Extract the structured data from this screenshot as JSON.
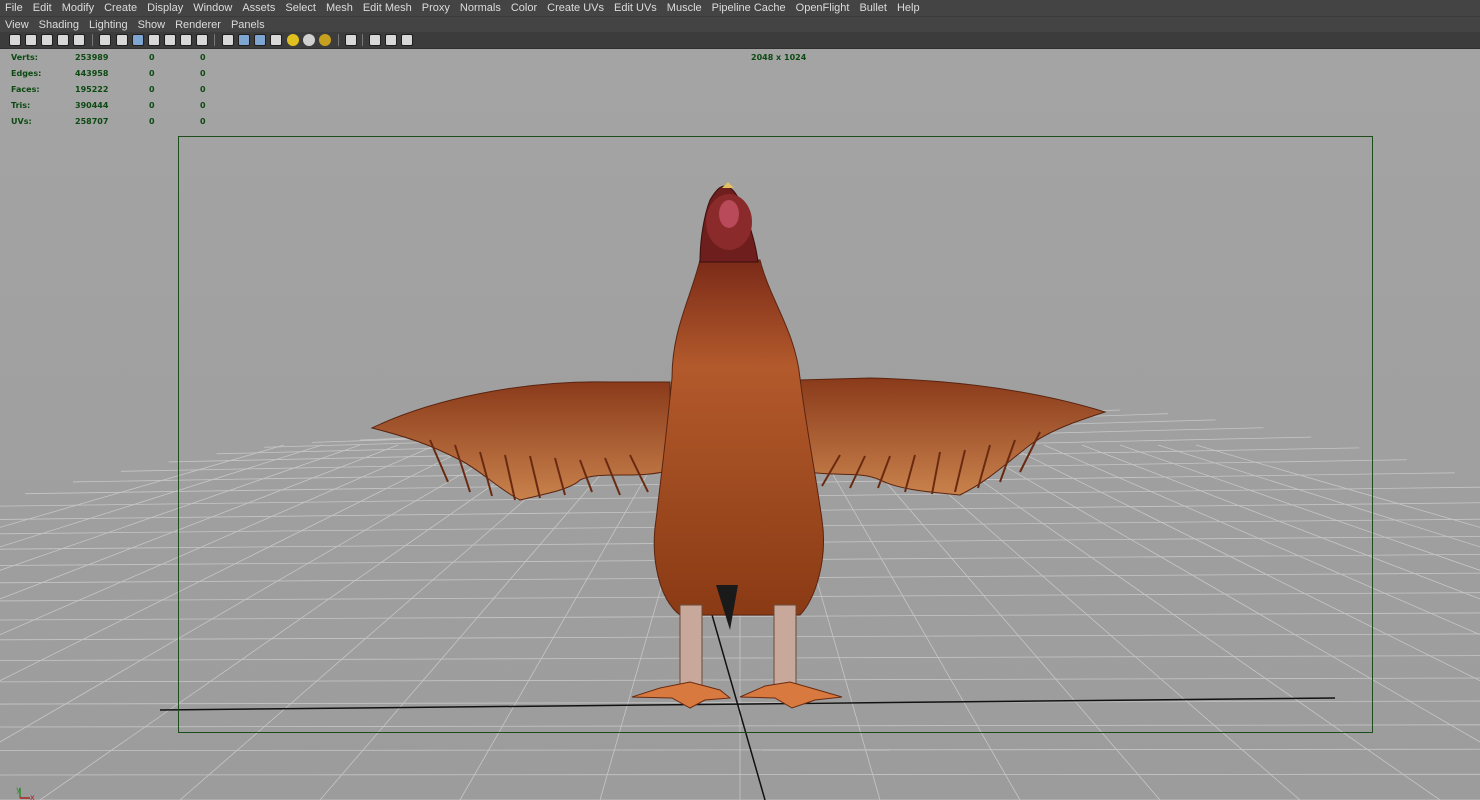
{
  "menubar": {
    "items": [
      "File",
      "Edit",
      "Modify",
      "Create",
      "Display",
      "Window",
      "Assets",
      "Select",
      "Mesh",
      "Edit Mesh",
      "Proxy",
      "Normals",
      "Color",
      "Create UVs",
      "Edit UVs",
      "Muscle",
      "Pipeline Cache",
      "OpenFlight",
      "Bullet",
      "Help"
    ]
  },
  "panel_menu": {
    "items": [
      "View",
      "Shading",
      "Lighting",
      "Show",
      "Renderer",
      "Panels"
    ]
  },
  "hud": {
    "rows": [
      {
        "label": "Verts:",
        "value": "253989",
        "selected": "0",
        "sel_comp": "0"
      },
      {
        "label": "Edges:",
        "value": "443958",
        "selected": "0",
        "sel_comp": "0"
      },
      {
        "label": "Faces:",
        "value": "195222",
        "selected": "0",
        "sel_comp": "0"
      },
      {
        "label": "Tris:",
        "value": "390444",
        "selected": "0",
        "sel_comp": "0"
      },
      {
        "label": "UVs:",
        "value": "258707",
        "selected": "0",
        "sel_comp": "0"
      }
    ],
    "resolution": "2048 x 1024"
  },
  "axis": {
    "y": "y",
    "x": "x"
  },
  "colors": {
    "menubar_bg": "#444444",
    "viewport_bg": "#a2a2a2",
    "hud_text": "#0c4a12",
    "grid_line": "#c8c8c8",
    "resolution_gate": "#1d4d1a",
    "chicken_body": "#a84a1c"
  },
  "icons": [
    "select-mask-icon",
    "snap-icon",
    "history-icon",
    "render-icon",
    "ipr-icon",
    "render-settings-icon",
    "camera-icon",
    "grid-icon",
    "film-gate-icon",
    "resolution-gate-icon",
    "field-chart-icon",
    "safe-action-icon",
    "wireframe-icon",
    "smooth-shade-icon",
    "textured-icon",
    "default-light-icon",
    "all-lights-icon",
    "shadows-icon",
    "isolate-icon",
    "xray-icon",
    "backface-icon"
  ]
}
